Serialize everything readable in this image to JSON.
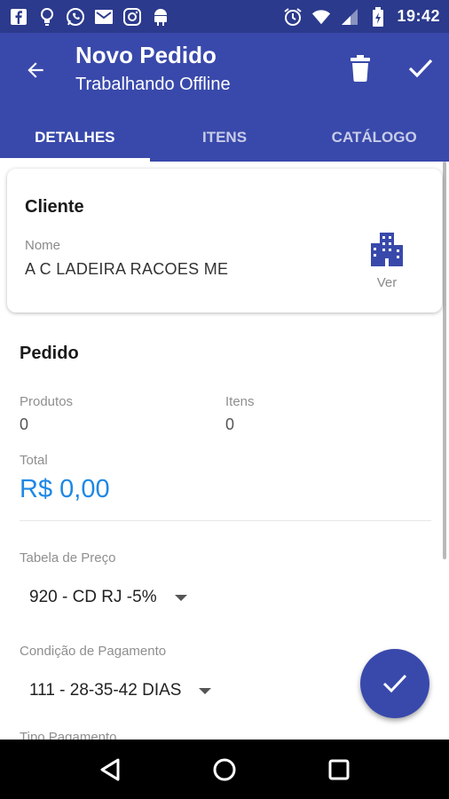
{
  "status_bar": {
    "time": "19:42",
    "left_icons": [
      "facebook-icon",
      "lightbulb-icon",
      "whatsapp-icon",
      "mail-icon",
      "instagram-icon",
      "android-icon"
    ],
    "right_icons": [
      "alarm-icon",
      "wifi-icon",
      "signal-icon",
      "battery-icon"
    ]
  },
  "app_bar": {
    "title": "Novo Pedido",
    "subtitle": "Trabalhando Offline",
    "back_icon": "arrow-back-icon",
    "delete_icon": "trash-icon",
    "done_icon": "check-icon",
    "color": "#3949ab"
  },
  "tabs": [
    {
      "label": "DETALHES",
      "active": true
    },
    {
      "label": "ITENS",
      "active": false
    },
    {
      "label": "CATÁLOGO",
      "active": false
    }
  ],
  "cliente": {
    "title": "Cliente",
    "nome_label": "Nome",
    "nome_value": "A C LADEIRA RACOES ME",
    "ver_label": "Ver",
    "ver_icon": "building-icon"
  },
  "pedido": {
    "title": "Pedido",
    "produtos_label": "Produtos",
    "produtos_value": "0",
    "itens_label": "Itens",
    "itens_value": "0",
    "total_label": "Total",
    "total_value": "R$ 0,00",
    "total_color": "#1e88e5"
  },
  "tabela_preco": {
    "label": "Tabela de Preço",
    "value": "920 - CD RJ -5%"
  },
  "condicao_pagamento": {
    "label": "Condição de Pagamento",
    "value": "111 - 28-35-42 DIAS"
  },
  "next_field_label_peek": "Tipo Pagamento",
  "fab": {
    "icon": "check-icon"
  },
  "nav_bar": {
    "buttons": [
      "back-triangle-icon",
      "home-circle-icon",
      "recents-square-icon"
    ]
  }
}
